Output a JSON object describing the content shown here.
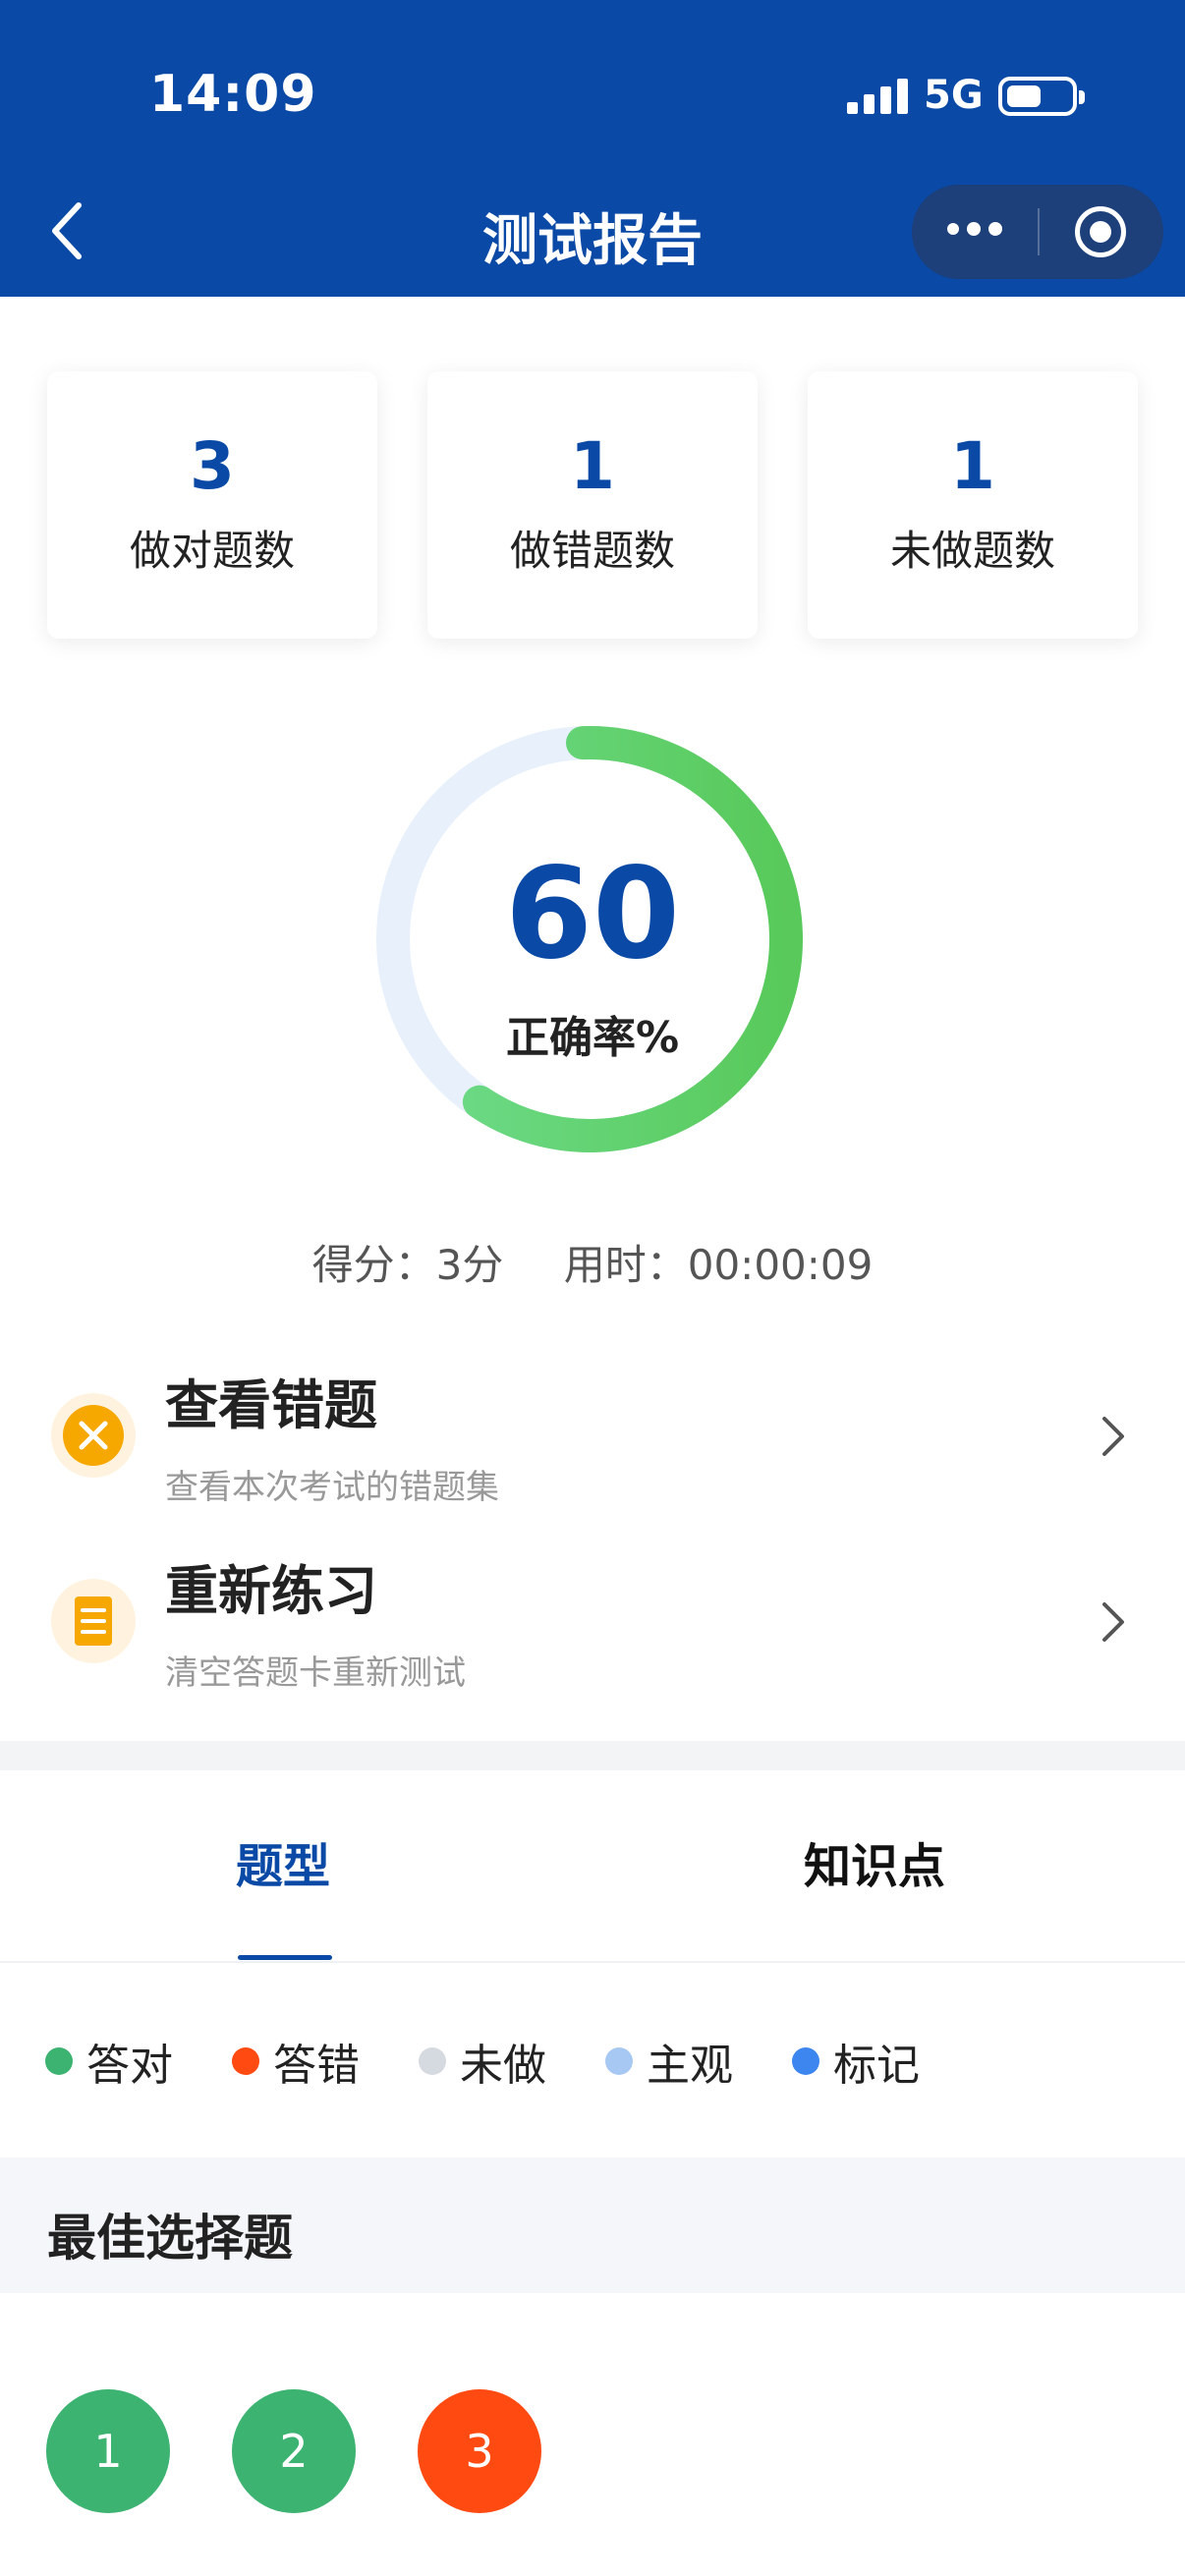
{
  "status_bar": {
    "time": "14:09",
    "network": "5G",
    "battery_level": 0.45
  },
  "nav": {
    "title": "测试报告",
    "back_icon": "chevron-left-icon",
    "more_icon": "more-icon",
    "target_icon": "target-icon"
  },
  "stats": [
    {
      "value": "3",
      "label": "做对题数"
    },
    {
      "value": "1",
      "label": "做错题数"
    },
    {
      "value": "1",
      "label": "未做题数"
    }
  ],
  "accuracy": {
    "value": "60",
    "label": "正确率%",
    "percent": 60
  },
  "summary": {
    "score": "得分：3分",
    "time": "用时：00:00:09"
  },
  "actions": [
    {
      "title": "查看错题",
      "subtitle": "查看本次考试的错题集",
      "icon": "close-circle-icon"
    },
    {
      "title": "重新练习",
      "subtitle": "清空答题卡重新测试",
      "icon": "document-icon"
    }
  ],
  "tabs": [
    {
      "label": "题型",
      "active": true
    },
    {
      "label": "知识点",
      "active": false
    }
  ],
  "legend": [
    {
      "label": "答对",
      "color": "#3cb371"
    },
    {
      "label": "答错",
      "color": "#ff4a12"
    },
    {
      "label": "未做",
      "color": "#d5d9e0"
    },
    {
      "label": "主观",
      "color": "#a7c8f2"
    },
    {
      "label": "标记",
      "color": "#3d86f0"
    }
  ],
  "section": {
    "title": "最佳选择题"
  },
  "questions": [
    {
      "number": "1",
      "status": "correct",
      "color": "#3cb371"
    },
    {
      "number": "2",
      "status": "correct",
      "color": "#3cb371"
    },
    {
      "number": "3",
      "status": "wrong",
      "color": "#ff4a12"
    }
  ],
  "colors": {
    "primary": "#0a4aa6",
    "ring_green": "#5fcf6a",
    "ring_track": "#e7f0fb"
  }
}
